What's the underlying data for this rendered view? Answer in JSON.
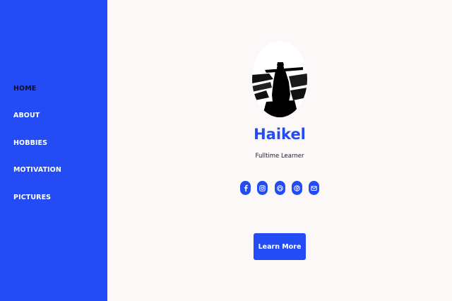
{
  "sidebar": {
    "items": [
      {
        "label": "HOME",
        "active": true
      },
      {
        "label": "ABOUT"
      },
      {
        "label": "HOBBIES"
      },
      {
        "label": "MOTIVATION"
      },
      {
        "label": "PICTURES"
      }
    ]
  },
  "profile": {
    "name": "Haikel",
    "tagline": "Fulltime Learner"
  },
  "social_links": [
    {
      "icon": "facebook-icon"
    },
    {
      "icon": "instagram-icon"
    },
    {
      "icon": "github-icon"
    },
    {
      "icon": "pinterest-icon"
    },
    {
      "icon": "mail-icon"
    }
  ],
  "cta": {
    "label": "Learn More"
  },
  "colors": {
    "accent": "#234cf4",
    "background": "#fdf8f8",
    "active_nav_text": "#0e0e2a"
  }
}
